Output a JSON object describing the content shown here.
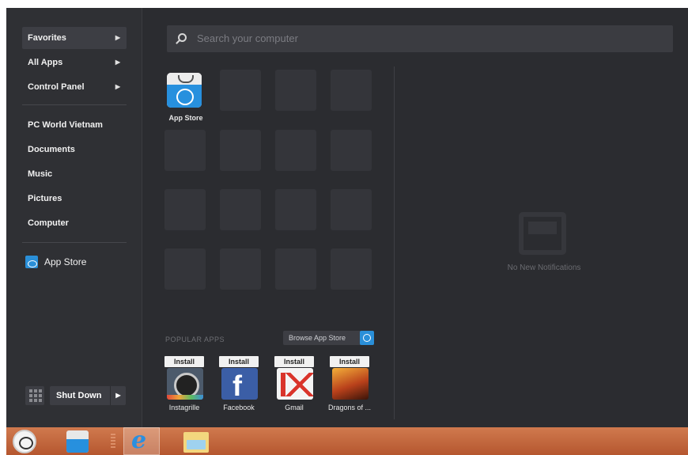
{
  "left_panel": {
    "items": [
      {
        "label": "Favorites",
        "arrow": "▶",
        "active": true
      },
      {
        "label": "All Apps",
        "arrow": "▶"
      },
      {
        "label": "Control Panel",
        "arrow": "▶"
      },
      {
        "label": "PC World Vietnam"
      },
      {
        "label": "Documents"
      },
      {
        "label": "Music"
      },
      {
        "label": "Pictures"
      },
      {
        "label": "Computer"
      }
    ],
    "pinned_app": "App Store",
    "shutdown_label": "Shut Down",
    "shutdown_arrow": "▶"
  },
  "search": {
    "placeholder": "Search your computer"
  },
  "tiles": {
    "app_store_label": "App Store"
  },
  "popular": {
    "title": "POPULAR APPS",
    "browse_label": "Browse App Store",
    "apps": [
      {
        "name": "Instagrille",
        "install": "Install"
      },
      {
        "name": "Facebook",
        "install": "Install"
      },
      {
        "name": "Gmail",
        "install": "Install"
      },
      {
        "name": "Dragons of ...",
        "install": "Install"
      }
    ]
  },
  "notifications": {
    "empty_text": "No New Notifications"
  },
  "colors": {
    "background": "#2b2c30",
    "accent": "#2a8fd8",
    "taskbar": "#c0643a"
  }
}
